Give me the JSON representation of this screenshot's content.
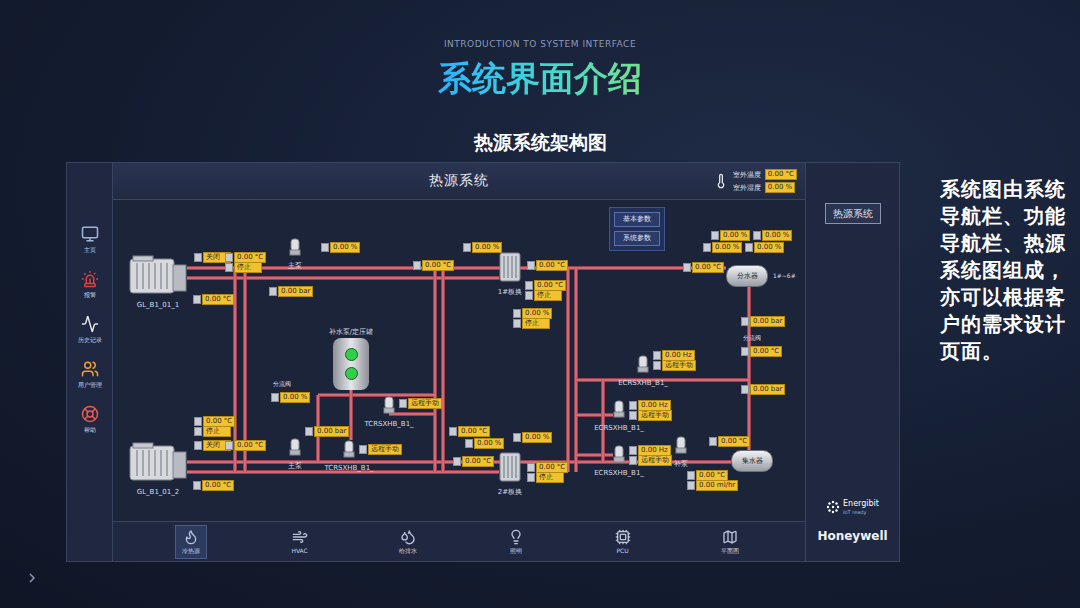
{
  "slide": {
    "caption": "INTRODUCTION TO SYSTEM INTERFACE",
    "title": "系统界面介绍",
    "subtitle": "热源系统架构图",
    "description": "系统图由系统导航栏、功能导航栏、热源系统图组成，亦可以根据客户的需求设计页面。"
  },
  "window": {
    "title": "热源系统"
  },
  "outdoor": [
    {
      "label": "室外温度",
      "value": "0.00 °C"
    },
    {
      "label": "室外湿度",
      "value": "0.00 %"
    }
  ],
  "sidebar": {
    "items": [
      {
        "label": "主页"
      },
      {
        "label": "报警"
      },
      {
        "label": "历史记录"
      },
      {
        "label": "用户管理"
      },
      {
        "label": "帮助"
      }
    ]
  },
  "right_nav": {
    "items": [
      {
        "label": "热源系统",
        "selected": true
      }
    ]
  },
  "logos": {
    "energibit": "Energibit",
    "energibit_tagline": "IoT ready",
    "honeywell": "Honeywell"
  },
  "bottom_nav": {
    "items": [
      {
        "label": "冷热源",
        "selected": true
      },
      {
        "label": "HVAC",
        "selected": false
      },
      {
        "label": "给排水",
        "selected": false
      },
      {
        "label": "照明",
        "selected": false
      },
      {
        "label": "PCU",
        "selected": false
      },
      {
        "label": "平面图",
        "selected": false
      }
    ]
  },
  "parameter_buttons": [
    "基本参数",
    "系统参数"
  ],
  "diagram": {
    "equipment": [
      {
        "kind": "boiler",
        "label": "GL_B1_01_1"
      },
      {
        "kind": "boiler",
        "label": "GL_B1_01_2"
      },
      {
        "kind": "pump",
        "label": "主泵"
      },
      {
        "kind": "pump",
        "label": "主泵"
      },
      {
        "kind": "exchanger",
        "label": "1#板换"
      },
      {
        "kind": "exchanger",
        "label": "2#板换"
      },
      {
        "kind": "tank",
        "label": "补水泵/定压罐",
        "indicators": [
          {
            "on": true
          },
          {
            "on": true
          }
        ]
      },
      {
        "kind": "pump",
        "label": "TCRSXHB_B1_"
      },
      {
        "kind": "pump",
        "label": "TCRSXHB_B1_"
      },
      {
        "kind": "pump",
        "label": "ECRSXHB_B1_"
      },
      {
        "kind": "pump",
        "label": "ECRSXHB_B1_"
      },
      {
        "kind": "pump",
        "label": "ECRSXHB_B1_"
      },
      {
        "kind": "header",
        "label": "分水器"
      },
      {
        "kind": "header",
        "label": "集水器"
      },
      {
        "kind": "pump",
        "label": "补泵"
      }
    ],
    "labels": [
      {
        "text": "1#~6#"
      },
      {
        "text": "分流阀"
      },
      {
        "text": "分流阀"
      }
    ],
    "tags": [
      {
        "text": "关闭"
      },
      {
        "text": "0.00 °C"
      },
      {
        "text": "停止"
      },
      {
        "text": "0.00 °C"
      },
      {
        "text": "0.00 %"
      },
      {
        "text": "0.00 bar"
      },
      {
        "text": "0.00 °C"
      },
      {
        "text": "0.00 %"
      },
      {
        "text": "0.00 °C"
      },
      {
        "text": "0.00 °C"
      },
      {
        "text": "停止"
      },
      {
        "text": "0.00 %"
      },
      {
        "text": "停止"
      },
      {
        "text": "0.00 %"
      },
      {
        "text": "0.00 %"
      },
      {
        "text": "0.00 %"
      },
      {
        "text": "0.00 %"
      },
      {
        "text": "0.00 °C"
      },
      {
        "text": "0.00 bar"
      },
      {
        "text": "0.00 °C"
      },
      {
        "text": "0.00 bar"
      },
      {
        "text": "0.00 °C"
      },
      {
        "text": "0.00 °C"
      },
      {
        "text": "0.00 ml/hr"
      },
      {
        "text": "0.00 Hz"
      },
      {
        "text": "远程手动"
      },
      {
        "text": "0.00 Hz"
      },
      {
        "text": "远程手动"
      },
      {
        "text": "0.00 Hz"
      },
      {
        "text": "远程手动"
      },
      {
        "text": "远程手动"
      },
      {
        "text": "远程手动"
      },
      {
        "text": "0.00 %"
      },
      {
        "text": "0.00 °C"
      },
      {
        "text": "停止"
      },
      {
        "text": "关闭"
      },
      {
        "text": "0.00 °C"
      },
      {
        "text": "0.00 bar"
      },
      {
        "text": "0.00 °C"
      },
      {
        "text": "0.00 °C"
      },
      {
        "text": "0.00 %"
      },
      {
        "text": "0.00 °C"
      },
      {
        "text": "0.00 °C"
      },
      {
        "text": "停止"
      },
      {
        "text": "0.00 %"
      }
    ]
  }
}
